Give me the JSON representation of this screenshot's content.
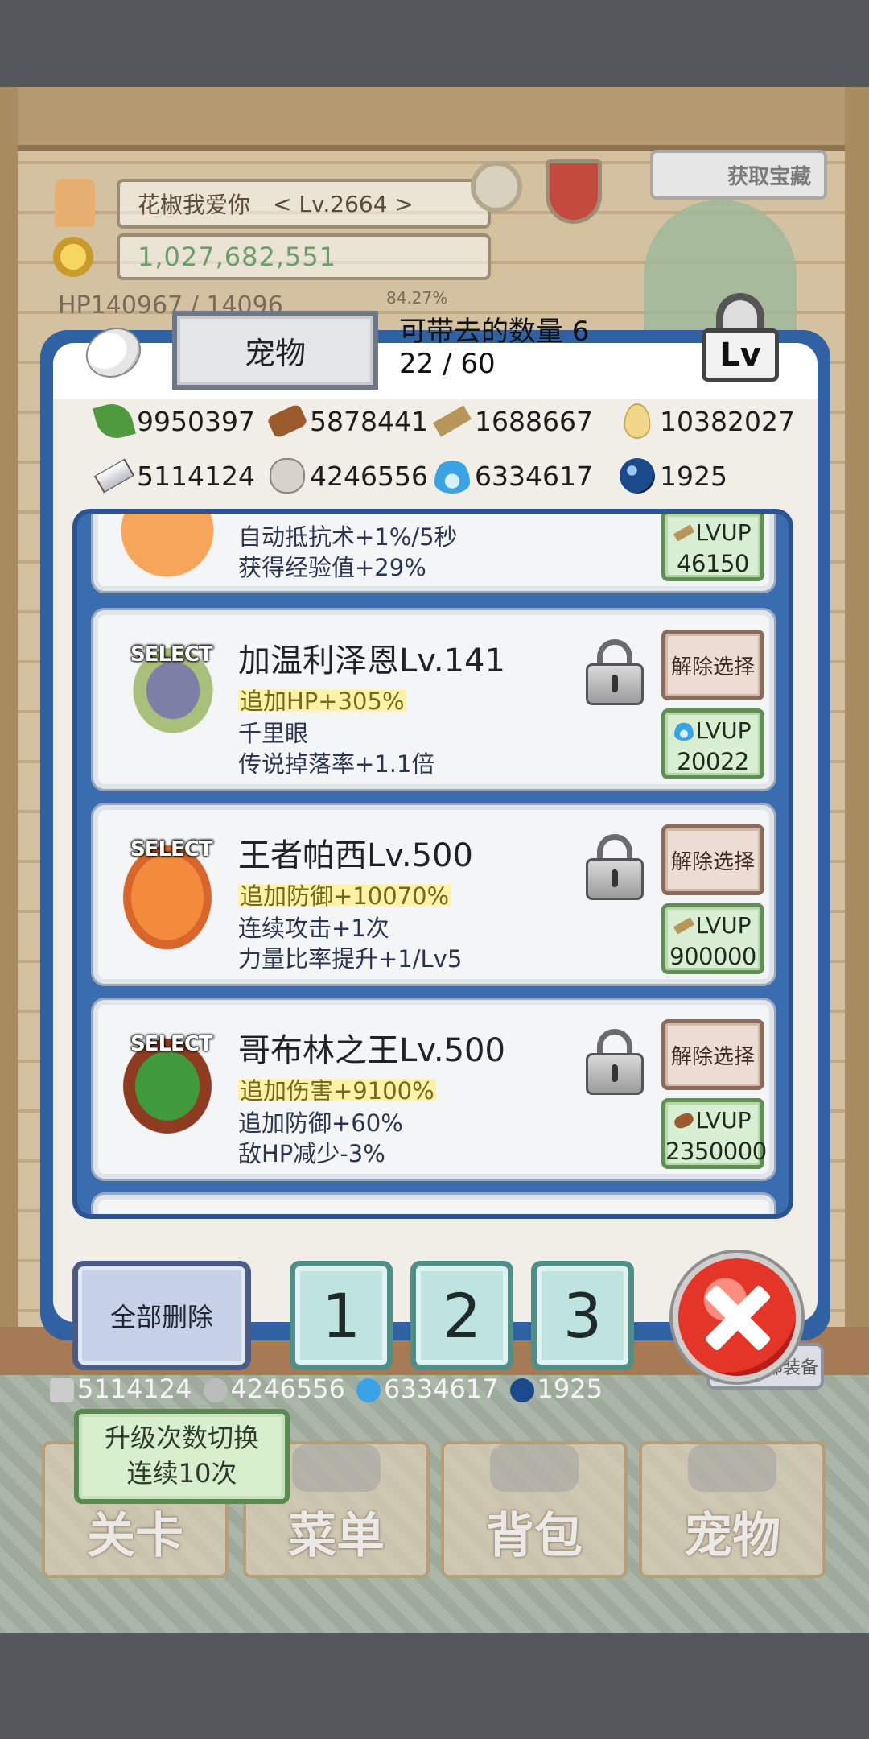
{
  "background": {
    "player_name": "花椒我爱你",
    "player_level": "< Lv.2664 >",
    "gold": "1,027,682,551",
    "hp_text": "HP140967 / 14096",
    "exp_percent": "84.27%",
    "treasure_label": "获取宝藏",
    "bottom_resources": [
      "5114124",
      "4246556",
      "6334617",
      "1925"
    ],
    "equip_button": "一键全部装备",
    "upgrade_toggle_line1": "升级次数切换",
    "upgrade_toggle_line2": "连续10次",
    "nav_tabs": [
      "关卡",
      "菜单",
      "背包",
      "宠物"
    ]
  },
  "modal": {
    "title": "宠物",
    "carry_label": "可带去的数量 6",
    "carry_count": "22 / 60",
    "lock_label": "Lv",
    "resources": [
      {
        "icon": "leaf-icon",
        "value": "9950397"
      },
      {
        "icon": "wood-log-icon",
        "value": "5878441"
      },
      {
        "icon": "plank-icon",
        "value": "1688667"
      },
      {
        "icon": "drop-icon",
        "value": "10382027"
      },
      {
        "icon": "iron-ingot-icon",
        "value": "5114124"
      },
      {
        "icon": "stone-icon",
        "value": "4246556"
      },
      {
        "icon": "blue-fire-icon",
        "value": "6334617"
      },
      {
        "icon": "dark-orb-icon",
        "value": "1925"
      }
    ],
    "pets": [
      {
        "partial": true,
        "line2": "自动抵抗术+1%/5秒",
        "line3": "获得经验值+29%",
        "lvup_label": "LVUP",
        "lvup_cost": "46150",
        "lvup_icon": "plank-icon"
      },
      {
        "select": "SELECT",
        "name": "加温利泽恩Lv.141",
        "line1": "追加HP+305%",
        "line2": "千里眼",
        "line3": "传说掉落率+1.1倍",
        "deselect": "解除选择",
        "lvup_label": "LVUP",
        "lvup_cost": "20022",
        "lvup_icon": "blue-fire-icon"
      },
      {
        "select": "SELECT",
        "name": "王者帕西Lv.500",
        "line1": "追加防御+10070%",
        "line2": "连续攻击+1次",
        "line3": "力量比率提升+1/Lv5",
        "deselect": "解除选择",
        "lvup_label": "LVUP",
        "lvup_cost": "900000",
        "lvup_icon": "plank-icon"
      },
      {
        "select": "SELECT",
        "name": "哥布林之王Lv.500",
        "line1": "追加伤害+9100%",
        "line2": "追加防御+60%",
        "line3": "敌HP减少-3%",
        "deselect": "解除选择",
        "lvup_label": "LVUP",
        "lvup_cost": "2350000",
        "lvup_icon": "wood-log-icon"
      }
    ],
    "delete_all": "全部删除",
    "preset_buttons": [
      "1",
      "2",
      "3"
    ]
  },
  "colors": {
    "modal_frame": "#2f61a3",
    "lvup_green": "#5f8f55",
    "deselect_brown": "#8a6b5c",
    "close_red": "#e43628"
  }
}
